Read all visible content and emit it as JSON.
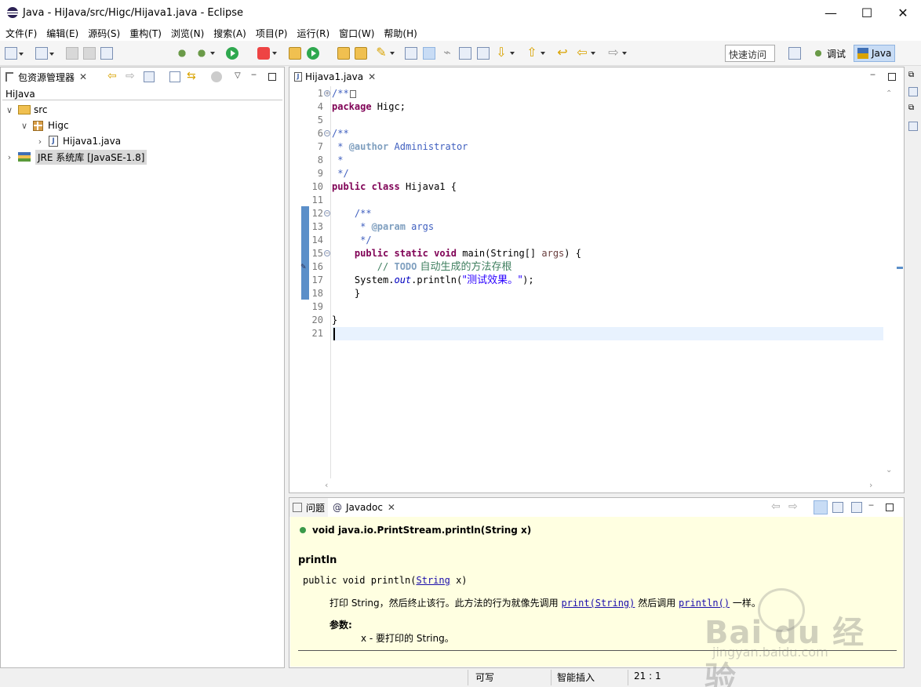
{
  "window": {
    "title": "Java  -  HiJava/src/Higc/Hijava1.java  -  Eclipse",
    "minimize": "—",
    "maximize": "☐",
    "close": "✕"
  },
  "menu": [
    "文件(F)",
    "编辑(E)",
    "源码(S)",
    "重构(T)",
    "浏览(N)",
    "搜索(A)",
    "项目(P)",
    "运行(R)",
    "窗口(W)",
    "帮助(H)"
  ],
  "toolbar": {
    "quick_access": "快速访问",
    "perspectives": [
      {
        "label": "调试",
        "icon": "bug-icon"
      },
      {
        "label": "Java",
        "icon": "java-perspective-icon",
        "active": true
      }
    ]
  },
  "explorer": {
    "tab_label": "包资源管理器",
    "close": "✕",
    "project": "HiJava",
    "tree": [
      {
        "label": "src",
        "twisty": "∨",
        "icon": "package-folder-icon"
      },
      {
        "label": "Higc",
        "twisty": "∨",
        "icon": "package-icon"
      },
      {
        "label": "Hijava1.java",
        "twisty": "›",
        "icon": "java-file-icon"
      },
      {
        "label": "JRE 系统库 [JavaSE-1.8]",
        "twisty": "›",
        "icon": "library-icon"
      }
    ]
  },
  "editor": {
    "tab_label": "Hijava1.java",
    "close": "✕",
    "line_numbers": [
      "1",
      "4",
      "5",
      "6",
      "7",
      "8",
      "9",
      "10",
      "11",
      "12",
      "13",
      "14",
      "15",
      "16",
      "17",
      "18",
      "19",
      "20",
      "21"
    ],
    "code": {
      "l1": "/**",
      "l4a": "package",
      "l4b": " Higc;",
      "l6": "/**",
      "l7a": " * ",
      "l7b": "@author",
      "l7c": " Administrator",
      "l8": " *",
      "l9": " */",
      "l10a": "public",
      "l10b": "class",
      "l10c": " Hijava1 {",
      "l12": "    /**",
      "l13a": "     * ",
      "l13b": "@param",
      "l13c": " args",
      "l14": "     */",
      "l15a": "public",
      "l15b": "static",
      "l15c": "void",
      "l15d": " main(String[] ",
      "l15e": "args",
      "l15f": ") {",
      "l16a": "        // ",
      "l16b": "TODO",
      "l16c": " 自动生成的方法存根",
      "l17a": "    System.",
      "l17b": "out",
      "l17c": ".println(",
      "l17d": "\"测试效果。\"",
      "l17e": ");",
      "l18": "    }",
      "l20": "}"
    }
  },
  "bottom": {
    "tabs": [
      {
        "label": "问题",
        "icon": "problems-icon"
      },
      {
        "label": "Javadoc",
        "icon": "at-icon"
      }
    ],
    "close": "✕",
    "javadoc": {
      "signature": "void java.io.PrintStream.println(String x)",
      "heading": "println",
      "decl_pre": "public void println(",
      "decl_link": "String",
      "decl_post": " x)",
      "desc_pre": "打印 String，然后终止该行。此方法的行为就像先调用 ",
      "desc_link1": "print(String)",
      "desc_mid": " 然后调用 ",
      "desc_link2": "println()",
      "desc_post": " 一样。",
      "params_heading": "参数:",
      "param_text": "x - 要打印的 String。"
    }
  },
  "status": {
    "writable": "可写",
    "insert_mode": "智能插入",
    "position": "21 :  1"
  },
  "watermark": {
    "brand": "Bai du 经验",
    "url": "jingyan.baidu.com"
  }
}
